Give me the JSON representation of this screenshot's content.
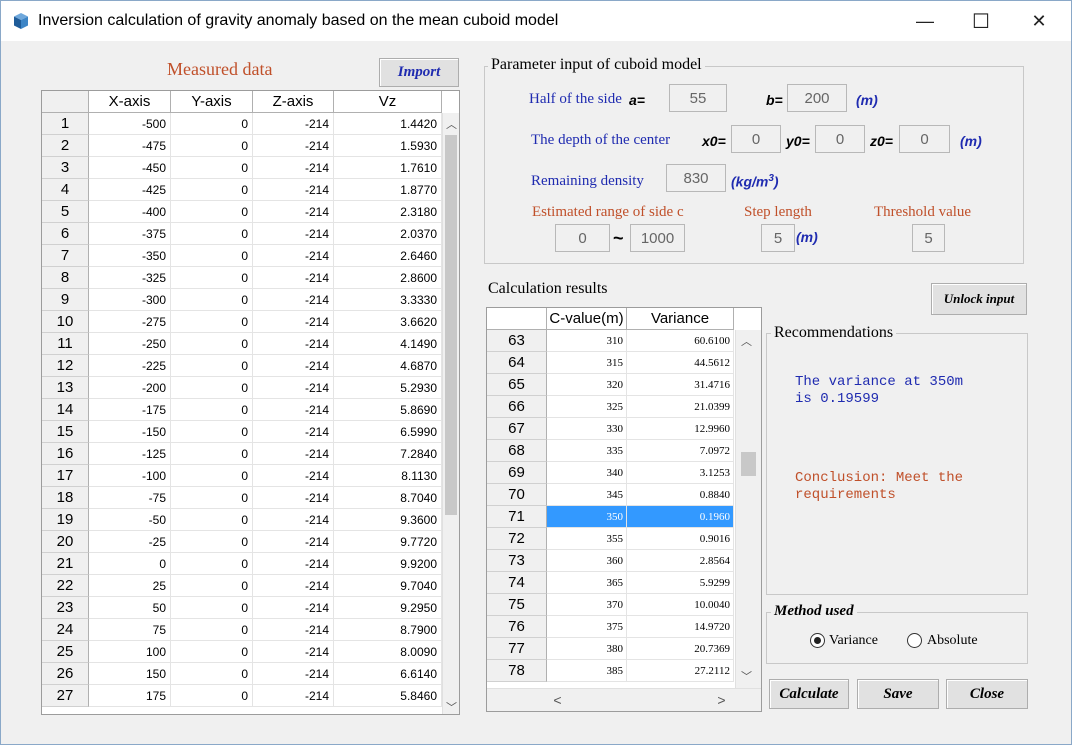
{
  "window": {
    "title": "Inversion calculation of gravity anomaly based on the mean cuboid model",
    "minimize": "—",
    "maximize": "☐",
    "close": "✕"
  },
  "measured": {
    "title": "Measured data",
    "import_label": "Import",
    "columns": [
      "X-axis",
      "Y-axis",
      "Z-axis",
      "Vz"
    ],
    "rows": [
      [
        "1",
        "-500",
        "0",
        "-214",
        "1.4420"
      ],
      [
        "2",
        "-475",
        "0",
        "-214",
        "1.5930"
      ],
      [
        "3",
        "-450",
        "0",
        "-214",
        "1.7610"
      ],
      [
        "4",
        "-425",
        "0",
        "-214",
        "1.8770"
      ],
      [
        "5",
        "-400",
        "0",
        "-214",
        "2.3180"
      ],
      [
        "6",
        "-375",
        "0",
        "-214",
        "2.0370"
      ],
      [
        "7",
        "-350",
        "0",
        "-214",
        "2.6460"
      ],
      [
        "8",
        "-325",
        "0",
        "-214",
        "2.8600"
      ],
      [
        "9",
        "-300",
        "0",
        "-214",
        "3.3330"
      ],
      [
        "10",
        "-275",
        "0",
        "-214",
        "3.6620"
      ],
      [
        "11",
        "-250",
        "0",
        "-214",
        "4.1490"
      ],
      [
        "12",
        "-225",
        "0",
        "-214",
        "4.6870"
      ],
      [
        "13",
        "-200",
        "0",
        "-214",
        "5.2930"
      ],
      [
        "14",
        "-175",
        "0",
        "-214",
        "5.8690"
      ],
      [
        "15",
        "-150",
        "0",
        "-214",
        "6.5990"
      ],
      [
        "16",
        "-125",
        "0",
        "-214",
        "7.2840"
      ],
      [
        "17",
        "-100",
        "0",
        "-214",
        "8.1130"
      ],
      [
        "18",
        "-75",
        "0",
        "-214",
        "8.7040"
      ],
      [
        "19",
        "-50",
        "0",
        "-214",
        "9.3600"
      ],
      [
        "20",
        "-25",
        "0",
        "-214",
        "9.7720"
      ],
      [
        "21",
        "0",
        "0",
        "-214",
        "9.9200"
      ],
      [
        "22",
        "25",
        "0",
        "-214",
        "9.7040"
      ],
      [
        "23",
        "50",
        "0",
        "-214",
        "9.2950"
      ],
      [
        "24",
        "75",
        "0",
        "-214",
        "8.7900"
      ],
      [
        "25",
        "100",
        "0",
        "-214",
        "8.0090"
      ],
      [
        "26",
        "150",
        "0",
        "-214",
        "6.6140"
      ],
      [
        "27",
        "175",
        "0",
        "-214",
        "5.8460"
      ]
    ]
  },
  "params": {
    "group_title": "Parameter input of cuboid model",
    "half_side_label": "Half of the side",
    "a_label": "a=",
    "a_value": "55",
    "b_label": "b=",
    "b_value": "200",
    "unit_m": "(m)",
    "depth_label": "The depth of the center",
    "x0_label": "x0=",
    "x0_value": "0",
    "y0_label": "y0=",
    "y0_value": "0",
    "z0_label": "z0=",
    "z0_value": "0",
    "density_label": "Remaining density",
    "density_value": "830",
    "density_unit": "(kg/m",
    "density_unit_sup": "3",
    "density_unit_close": ")",
    "range_label": "Estimated range of side c",
    "range_from": "0",
    "range_tilde": "~",
    "range_to": "1000",
    "step_label": "Step length",
    "step_value": "5",
    "threshold_label": "Threshold value",
    "threshold_value": "5"
  },
  "results": {
    "title": "Calculation results",
    "unlock_label": "Unlock input",
    "columns": [
      "C-value(m)",
      "Variance"
    ],
    "selected_row": "71",
    "rows": [
      [
        "63",
        "310",
        "60.6100"
      ],
      [
        "64",
        "315",
        "44.5612"
      ],
      [
        "65",
        "320",
        "31.4716"
      ],
      [
        "66",
        "325",
        "21.0399"
      ],
      [
        "67",
        "330",
        "12.9960"
      ],
      [
        "68",
        "335",
        "7.0972"
      ],
      [
        "69",
        "340",
        "3.1253"
      ],
      [
        "70",
        "345",
        "0.8840"
      ],
      [
        "71",
        "350",
        "0.1960"
      ],
      [
        "72",
        "355",
        "0.9016"
      ],
      [
        "73",
        "360",
        "2.8564"
      ],
      [
        "74",
        "365",
        "5.9299"
      ],
      [
        "75",
        "370",
        "10.0040"
      ],
      [
        "76",
        "375",
        "14.9720"
      ],
      [
        "77",
        "380",
        "20.7369"
      ],
      [
        "78",
        "385",
        "27.2112"
      ]
    ]
  },
  "recommendations": {
    "title": "Recommendations",
    "variance_text": "The variance at 350m\nis 0.19599",
    "conclusion_text": "Conclusion: Meet the\nrequirements",
    "text_blue": "#1f2bb0",
    "text_red": "#c0502a"
  },
  "method": {
    "title": "Method used",
    "options": [
      "Variance",
      "Absolute"
    ],
    "selected": "Variance"
  },
  "buttons": {
    "calculate": "Calculate",
    "save": "Save",
    "close": "Close"
  },
  "colors": {
    "selection": "#3399ff",
    "label_blue": "#1f2bb0",
    "label_red": "#c0502a"
  }
}
